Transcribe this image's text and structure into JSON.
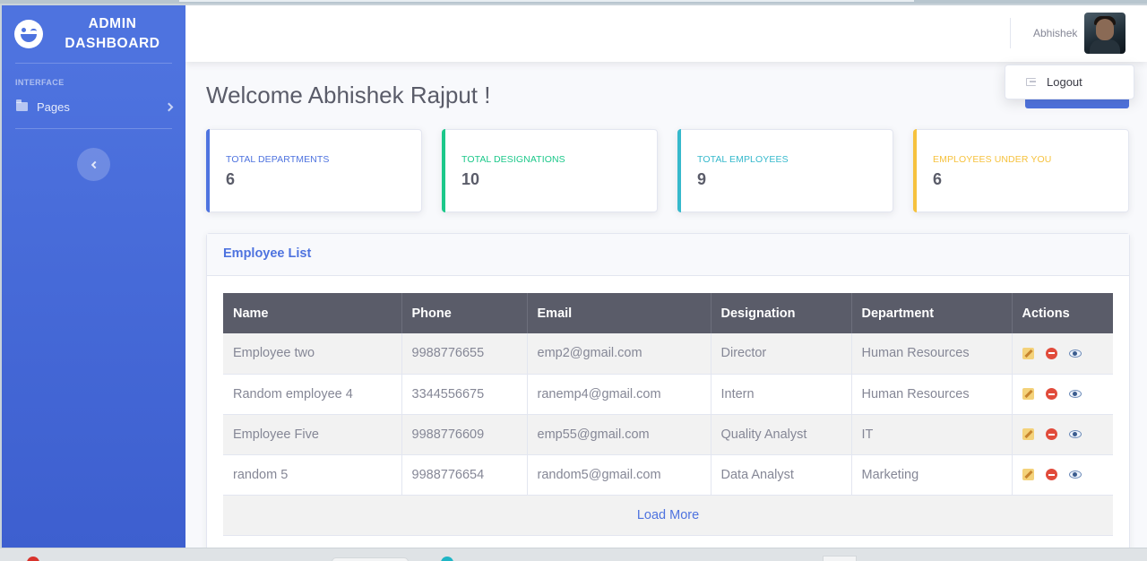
{
  "brand": {
    "line1": "ADMIN",
    "line2": "DASHBOARD"
  },
  "sidebar": {
    "heading": "INTERFACE",
    "items": [
      {
        "label": "Pages"
      }
    ]
  },
  "topbar": {
    "user_name": "Abhishek",
    "dropdown": {
      "logout_label": "Logout"
    }
  },
  "welcome": "Welcome Abhishek Rajput !",
  "stats": [
    {
      "label": "TOTAL DEPARTMENTS",
      "value": "6",
      "color": "#4e73df"
    },
    {
      "label": "TOTAL DESIGNATIONS",
      "value": "10",
      "color": "#1cc88a"
    },
    {
      "label": "TOTAL EMPLOYEES",
      "value": "9",
      "color": "#36b9cc"
    },
    {
      "label": "EMPLOYEES UNDER YOU",
      "value": "6",
      "color": "#f6c23e"
    }
  ],
  "employee_list": {
    "title": "Employee List",
    "columns": [
      "Name",
      "Phone",
      "Email",
      "Designation",
      "Department",
      "Actions"
    ],
    "rows": [
      {
        "name": "Employee two",
        "phone": "9988776655",
        "email": "emp2@gmail.com",
        "designation": "Director",
        "department": "Human Resources"
      },
      {
        "name": "Random employee 4",
        "phone": "3344556675",
        "email": "ranemp4@gmail.com",
        "designation": "Intern",
        "department": "Human Resources"
      },
      {
        "name": "Employee Five",
        "phone": "9988776609",
        "email": "emp55@gmail.com",
        "designation": "Quality Analyst",
        "department": "IT"
      },
      {
        "name": "random 5",
        "phone": "9988776654",
        "email": "random5@gmail.com",
        "designation": "Data Analyst",
        "department": "Marketing"
      }
    ],
    "load_more_label": "Load More",
    "row_action_icons": [
      "edit-icon",
      "delete-icon",
      "view-icon"
    ]
  },
  "colors": {
    "primary": "#4e73df",
    "success": "#1cc88a",
    "info": "#36b9cc",
    "warning": "#f6c23e",
    "table_header": "#5a5c69"
  }
}
